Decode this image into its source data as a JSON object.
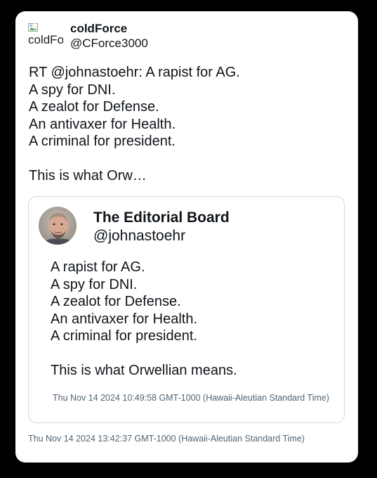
{
  "tweet": {
    "author": {
      "avatar_alt": "coldForce",
      "display_name": "coldForce",
      "handle": "@CForce3000"
    },
    "text_lines": [
      "RT @johnastoehr: A rapist for AG.",
      "A spy for DNI.",
      "A zealot for Defense.",
      "An antivaxer for Health.",
      "A criminal for president.",
      "",
      "This is what Orw…"
    ],
    "timestamp": "Thu Nov 14 2024 13:42:37 GMT-1000 (Hawaii-Aleutian Standard Time)"
  },
  "quoted_tweet": {
    "author": {
      "display_name": "The Editorial Board",
      "handle": "@johnastoehr"
    },
    "text_lines": [
      "A rapist for AG.",
      "A spy for DNI.",
      "A zealot for Defense.",
      "An antivaxer for Health.",
      "A criminal for president.",
      "",
      "This is what Orwellian means."
    ],
    "timestamp": "Thu Nov 14 2024 10:49:58 GMT-1000 (Hawaii-Aleutian Standard Time)"
  },
  "icons": {
    "author_avatar": "broken-image-icon",
    "quoted_avatar": "avatar-photo"
  },
  "colors": {
    "background": "#000000",
    "card": "#ffffff",
    "text": "#0f1419",
    "muted": "#536471",
    "border": "#cfd9de"
  }
}
